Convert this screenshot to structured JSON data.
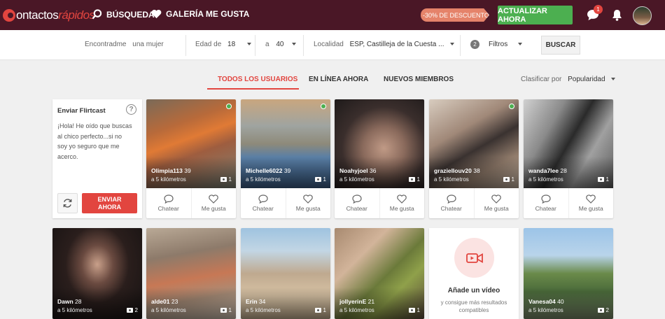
{
  "brand": {
    "name_part1": "ontactos",
    "name_part2": "rápidos"
  },
  "nav": {
    "search": "BÚSQUEDA",
    "gallery": "GALERÍA ME GUSTA"
  },
  "promo": {
    "discount": "-30% DE DESCUENTO",
    "upgrade": "ACTUALIZAR AHORA"
  },
  "notifications": {
    "chat_badge": "1"
  },
  "search": {
    "find_label": "Encontradme",
    "find_value": "una mujer",
    "age_from_label": "Edad de",
    "age_from": "18",
    "age_to_label": "a",
    "age_to": "40",
    "location_label": "Localidad",
    "location_value": "ESP, Castilleja de la Cuesta ...",
    "filters_count": "2",
    "filters_label": "Filtros",
    "button": "BUSCAR"
  },
  "tabs": {
    "all": "TODOS LOS USUARIOS",
    "online": "EN LÍNEA AHORA",
    "new": "NUEVOS MIEMBROS"
  },
  "sort": {
    "label": "Clasificar por",
    "value": "Popularidad"
  },
  "flirtcast": {
    "title": "Enviar Flirtcast",
    "text": "¡Hola! He oído que buscas al chico perfecto...si no soy yo seguro que me acerco.",
    "send": "ENVIAR AHORA"
  },
  "actions": {
    "chat": "Chatear",
    "like": "Me gusta"
  },
  "users_row1": [
    {
      "name": "Olimpia113",
      "age": "39",
      "distance": "a 5 kilómetros",
      "photos": "1",
      "online": true
    },
    {
      "name": "Michelle6022",
      "age": "39",
      "distance": "a 5 kilómetros",
      "photos": "1",
      "online": true
    },
    {
      "name": "Noahyjoel",
      "age": "36",
      "distance": "a 5 kilómetros",
      "photos": "1",
      "online": false
    },
    {
      "name": "graziellouv20",
      "age": "38",
      "distance": "a 5 kilómetros",
      "photos": "1",
      "online": true
    },
    {
      "name": "wanda7lee",
      "age": "28",
      "distance": "a 5 kilómetros",
      "photos": "1",
      "online": false
    }
  ],
  "users_row2": [
    {
      "name": "Dawn",
      "age": "28",
      "distance": "a 5 kilómetros",
      "photos": "2"
    },
    {
      "name": "alde01",
      "age": "23",
      "distance": "a 5 kilómetros",
      "photos": "1"
    },
    {
      "name": "Erin",
      "age": "34",
      "distance": "a 5 kilómetros",
      "photos": "1"
    },
    {
      "name": "jollyerinE",
      "age": "21",
      "distance": "a 5 kilómetros",
      "photos": "1"
    },
    {
      "name": "Vanesa04",
      "age": "40",
      "distance": "a 5 kilómetros",
      "photos": "2"
    }
  ],
  "video_prompt": {
    "title": "Añade un vídeo",
    "text": "y consigue más resultados compatibles"
  },
  "colors": {
    "brand": "#4a1726",
    "accent": "#e2453f",
    "upgrade": "#4caf50",
    "online": "#4caf50"
  }
}
